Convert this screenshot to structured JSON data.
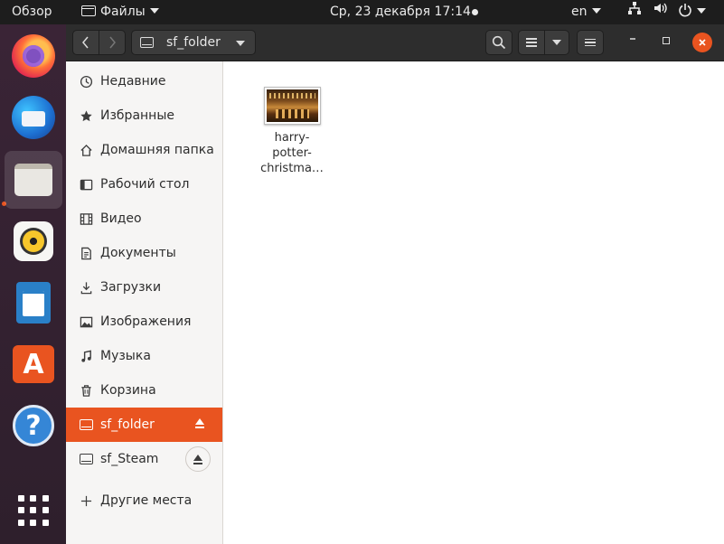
{
  "topbar": {
    "activities": "Обзор",
    "app_name": "Файлы",
    "clock": "Ср, 23 декабря  17:14",
    "lang": "en"
  },
  "dock": {
    "items": [
      "firefox-icon",
      "thunderbird-icon",
      "files-icon",
      "rhythmbox-icon",
      "libreoffice-writer-icon",
      "ubuntu-software-icon",
      "help-icon",
      "show-applications-icon"
    ],
    "active": "files-icon",
    "help_glyph": "?",
    "store_glyph": "A"
  },
  "header": {
    "path": "sf_folder"
  },
  "sidebar": {
    "items": [
      {
        "label": "Недавние",
        "icon": "clock-icon"
      },
      {
        "label": "Избранные",
        "icon": "star-icon"
      },
      {
        "label": "Домашняя папка",
        "icon": "home-icon"
      },
      {
        "label": "Рабочий стол",
        "icon": "desktop-icon"
      },
      {
        "label": "Видео",
        "icon": "video-icon"
      },
      {
        "label": "Документы",
        "icon": "document-icon"
      },
      {
        "label": "Загрузки",
        "icon": "download-icon"
      },
      {
        "label": "Изображения",
        "icon": "image-icon"
      },
      {
        "label": "Музыка",
        "icon": "music-icon"
      },
      {
        "label": "Корзина",
        "icon": "trash-icon"
      },
      {
        "label": "sf_folder",
        "icon": "drive-icon",
        "selected": true
      },
      {
        "label": "sf_Steam",
        "icon": "drive-icon"
      },
      {
        "label": "Другие места",
        "icon": "plus-icon"
      }
    ]
  },
  "content": {
    "files": [
      {
        "name_lines": [
          "harry-",
          "potter-",
          "christma…"
        ],
        "type": "image"
      }
    ]
  },
  "colors": {
    "accent": "#e95420",
    "topbar": "#1d1d1d",
    "header": "#2d2d2d",
    "sidebar": "#f6f5f4"
  }
}
